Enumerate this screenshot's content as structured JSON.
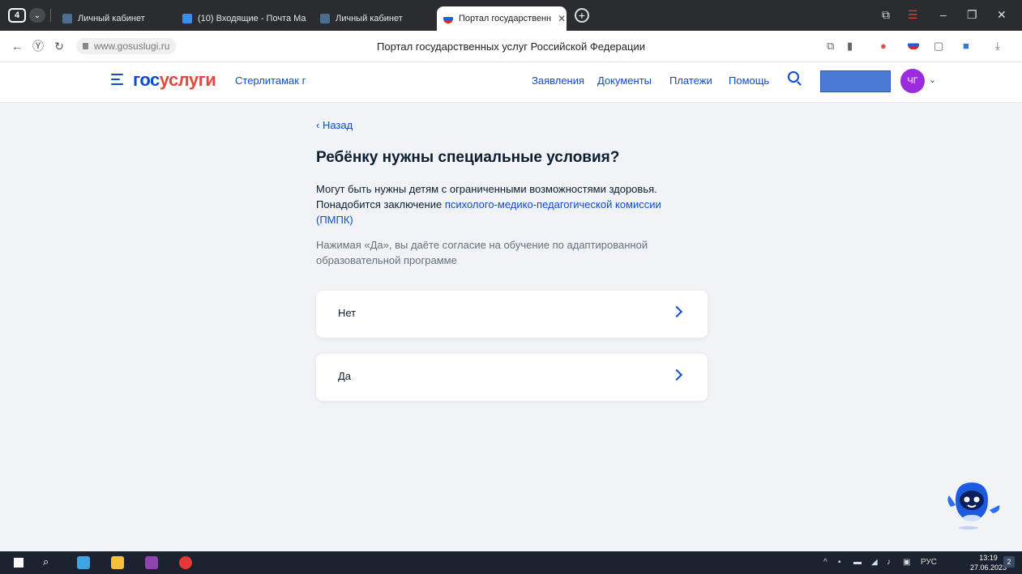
{
  "browser": {
    "tab_count": "4",
    "tabs": [
      {
        "title": "Личный кабинет"
      },
      {
        "title": "(10) Входящие - Почта Ма"
      },
      {
        "title": "Личный кабинет"
      },
      {
        "title": "Портал государственн"
      }
    ],
    "url": "www.gosuslugi.ru",
    "page_title": "Портал государственных услуг Российской Федерации"
  },
  "header": {
    "logo_part1": "гос",
    "logo_part2": "услуги",
    "city": "Стерлитамак г",
    "nav": [
      "Заявления",
      "Документы",
      "Платежи",
      "Помощь"
    ],
    "avatar_initials": "ЧГ"
  },
  "main": {
    "back_label": "‹ Назад",
    "title": "Ребёнку нужны специальные условия?",
    "description_text": "Могут быть нужны детям с ограниченными возможностями здоровья. Понадобится заключение ",
    "description_link": "психолого-медико-педагогической комиссии (ПМПК)",
    "consent": "Нажимая «Да», вы даёте согласие на обучение по адаптированной образовательной программе",
    "options": [
      {
        "label": "Нет"
      },
      {
        "label": "Да"
      }
    ]
  },
  "taskbar": {
    "language": "РУС",
    "time": "13:19",
    "date": "27.06.2023",
    "notification_count": "2"
  },
  "colors": {
    "accent": "#0d4cd3",
    "logo_red": "#e4473c",
    "page_bg": "#f1f3f6",
    "avatar": "#9b2bde"
  }
}
